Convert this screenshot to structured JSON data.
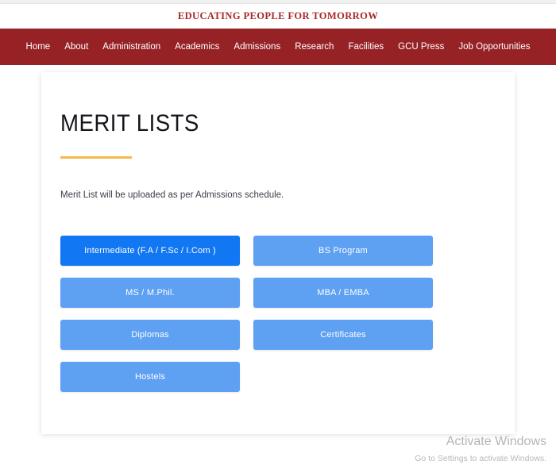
{
  "site": {
    "tagline": "EDUCATING PEOPLE FOR TOMORROW",
    "brand_color": "#962226",
    "accent_color": "#f5b74e",
    "button_color": "#5ea0f2",
    "button_active_color": "#1277f3"
  },
  "nav": {
    "items": [
      {
        "label": "Home"
      },
      {
        "label": "About"
      },
      {
        "label": "Administration"
      },
      {
        "label": "Academics"
      },
      {
        "label": "Admissions"
      },
      {
        "label": "Research"
      },
      {
        "label": "Facilities"
      },
      {
        "label": "GCU Press"
      },
      {
        "label": "Job Opportunities"
      }
    ]
  },
  "main": {
    "title": "MERIT LISTS",
    "intro": "Merit List will be uploaded as per Admissions schedule.",
    "buttons": [
      {
        "label": "Intermediate (F.A / F.Sc / I.Com )",
        "active": true
      },
      {
        "label": "BS Program",
        "active": false
      },
      {
        "label": "MS / M.Phil.",
        "active": false
      },
      {
        "label": "MBA / EMBA",
        "active": false
      },
      {
        "label": "Diplomas",
        "active": false
      },
      {
        "label": "Certificates",
        "active": false
      },
      {
        "label": "Hostels",
        "active": false
      }
    ]
  },
  "watermark": {
    "title": "Activate Windows",
    "subtitle": "Go to Settings to activate Windows."
  }
}
